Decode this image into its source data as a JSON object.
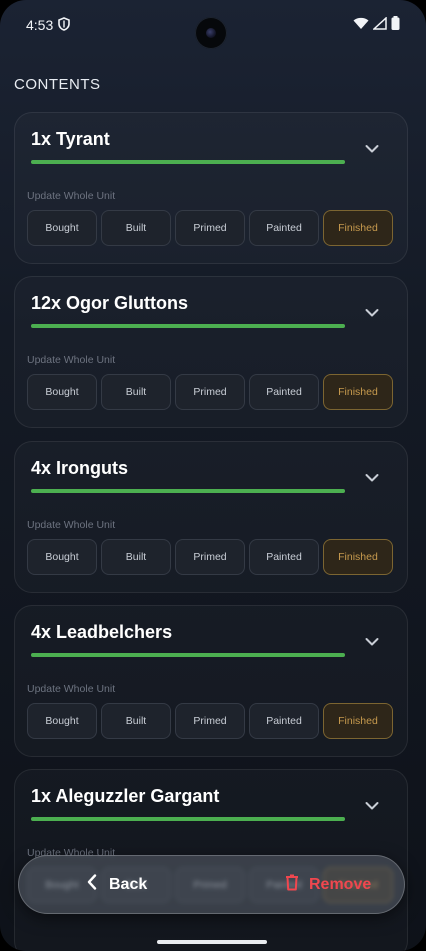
{
  "status": {
    "time": "4:53"
  },
  "section_title": "CONTENTS",
  "units": [
    {
      "title": "1x Tyrant",
      "progress": 1.0,
      "update_label": "Update Whole Unit",
      "stages": [
        "Bought",
        "Built",
        "Primed",
        "Painted",
        "Finished"
      ],
      "active_stage": "Finished"
    },
    {
      "title": "12x Ogor Gluttons",
      "progress": 1.0,
      "update_label": "Update Whole Unit",
      "stages": [
        "Bought",
        "Built",
        "Primed",
        "Painted",
        "Finished"
      ],
      "active_stage": "Finished"
    },
    {
      "title": "4x Ironguts",
      "progress": 1.0,
      "update_label": "Update Whole Unit",
      "stages": [
        "Bought",
        "Built",
        "Primed",
        "Painted",
        "Finished"
      ],
      "active_stage": "Finished"
    },
    {
      "title": "4x Leadbelchers",
      "progress": 1.0,
      "update_label": "Update Whole Unit",
      "stages": [
        "Bought",
        "Built",
        "Primed",
        "Painted",
        "Finished"
      ],
      "active_stage": "Finished"
    },
    {
      "title": "1x Aleguzzler Gargant",
      "progress": 1.0,
      "update_label": "Update Whole Unit",
      "stages": [
        "Bought",
        "Built",
        "Primed",
        "Painted",
        "Finished"
      ],
      "active_stage": "Finished"
    }
  ],
  "actions": {
    "back_label": "Back",
    "remove_label": "Remove"
  },
  "colors": {
    "progress": "#4caf50",
    "active_stage": "#c79a4e",
    "remove": "#f0474f"
  },
  "icons": {
    "back": "chevron-left-icon",
    "remove": "trash-icon",
    "expand": "chevron-down-icon"
  }
}
